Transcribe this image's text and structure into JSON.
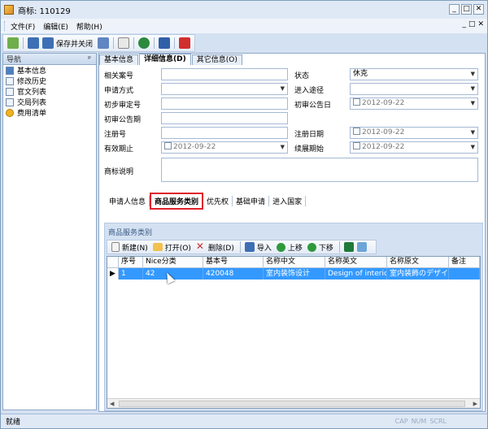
{
  "window": {
    "title": "商标: 110129",
    "controls": [
      "_",
      "□",
      "✕"
    ]
  },
  "menu": {
    "file": "文件(F)",
    "edit": "编辑(E)",
    "help": "帮助(H)",
    "mdi_controls": [
      "_",
      "□",
      "✕"
    ]
  },
  "toolbar": {
    "save_close": "保存并关闭"
  },
  "nav": {
    "header": "导航",
    "pin": "ᵖ",
    "items": [
      "基本信息",
      "修改历史",
      "官文列表",
      "交局列表",
      "费用清单"
    ]
  },
  "tabs": [
    "基本信息",
    "详细信息(D)",
    "其它信息(O)"
  ],
  "form": {
    "related_case": "相关案号",
    "status_label": "状态",
    "status_value": "休克",
    "apply_method": "申请方式",
    "entry_route": "进入途径",
    "prelim_no": "初步审定号",
    "prelim_date": "初审公告日",
    "prelim_date_value": "2012-09-22",
    "prelim_period": "初审公告期",
    "reg_no": "注册号",
    "reg_date": "注册日期",
    "reg_date_value": "2012-09-22",
    "valid_until": "有效期止",
    "valid_until_value": "2012-09-22",
    "renew_start": "续展期始",
    "renew_start_value": "2012-09-22",
    "tm_desc": "商标说明"
  },
  "subtabs": [
    "申请人信息",
    "商品服务类别",
    "优先权",
    "基础申请",
    "进入国家"
  ],
  "grid": {
    "panel_title": "商品服务类别",
    "tools": {
      "new": "新建(N)",
      "open": "打开(O)",
      "delete": "删除(D)",
      "import": "导入",
      "up": "上移",
      "down": "下移"
    },
    "columns": [
      "序号",
      "Nice分类",
      "基本号",
      "名称中文",
      "名称英文",
      "名称原文",
      "备注"
    ],
    "rows": [
      [
        "1",
        "42",
        "420048",
        "室内装饰设计",
        "Design of interic",
        "室内装飾のデザイ",
        ""
      ]
    ]
  },
  "status": {
    "text": "就绪",
    "keys": [
      "CAP",
      "NUM",
      "SCRL"
    ]
  }
}
